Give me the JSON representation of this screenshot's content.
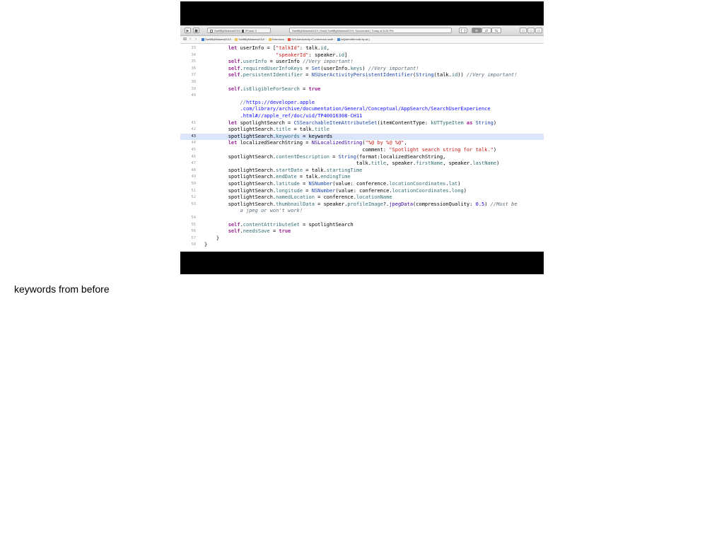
{
  "toolbar": {
    "scheme": "SwiftByMidwest2019",
    "device": "iPhone X",
    "status": "SwiftByMidwest2019 | Build SwiftByMidwest2019: Succeeded | Today at 8:28 PM"
  },
  "jumpbar": {
    "back": "‹",
    "forward": "›",
    "crumbs": [
      "SwiftByMidwest2019",
      "SwiftByMidwest2019",
      "Extension",
      "NSUserActivity+Conference.swift",
      "init(identifier:talk:by:at:)"
    ]
  },
  "code_lines": [
    {
      "n": "33",
      "html": "        <span class=\"kw\">let</span> userInfo = [<span class=\"str\">\"talkId\"</span>: talk.<span class=\"prop\">id</span>,"
    },
    {
      "n": "34",
      "html": "                        <span class=\"str\">\"speakerId\"</span>: speaker.<span class=\"prop\">id</span>]"
    },
    {
      "n": "35",
      "html": "        <span class=\"kw\">self</span>.<span class=\"prop\">userInfo</span> = userInfo <span class=\"cmt\">//Very important!</span>"
    },
    {
      "n": "36",
      "html": "        <span class=\"kw\">self</span>.<span class=\"prop\">requiredUserInfoKeys</span> = <span class=\"typ\">Set</span>(userInfo.<span class=\"prop\">keys</span>) <span class=\"cmt\">//Very important!</span>"
    },
    {
      "n": "37",
      "html": "        <span class=\"kw\">self</span>.<span class=\"prop\">persistentIdentifier</span> = <span class=\"typ\">NSUserActivityPersistentIdentifier</span>(<span class=\"typ\">String</span>(talk.<span class=\"prop\">id</span>)) <span class=\"cmt\">//Very important!</span>"
    },
    {
      "n": "38",
      "html": ""
    },
    {
      "n": "39",
      "html": "        <span class=\"kw\">self</span>.<span class=\"prop\">isEligibleForSearch</span> = <span class=\"kw\">true</span>"
    },
    {
      "n": "40",
      "html": ""
    },
    {
      "n": "",
      "html": "            <span class=\"cmt\">//</span><span class=\"url\">https://developer.apple</span>"
    },
    {
      "n": "",
      "html": "            <span class=\"url\">.com/library/archive/documentation/General/Conceptual/AppSearch/SearchUserExperience</span>"
    },
    {
      "n": "",
      "html": "            <span class=\"url\">.html#//apple_ref/doc/uid/TP40016308-CH11</span>"
    },
    {
      "n": "41",
      "html": "        <span class=\"kw\">let</span> spotlightSearch = <span class=\"typ\">CSSearchableItemAttributeSet</span>(itemContentType: <span class=\"prop\">kUTTypeItem</span> <span class=\"kw\">as</span> <span class=\"typ\">String</span>)"
    },
    {
      "n": "42",
      "html": "        spotlightSearch.<span class=\"prop\">title</span> = talk.<span class=\"prop\">title</span>"
    },
    {
      "n": "43",
      "html": "        spotlightSearch.<span class=\"prop\">keywords</span> = keywords",
      "current": true
    },
    {
      "n": "44",
      "html": "        <span class=\"kw\">let</span> localizedSearchString = <span class=\"fn\">NSLocalizedString</span>(<span class=\"str\">\"%@ by %@ %@\"</span>,"
    },
    {
      "n": "45",
      "html": "                                                     comment: <span class=\"str\">\"Spotlight search string for talk.\"</span>)"
    },
    {
      "n": "46",
      "html": "        spotlightSearch.<span class=\"prop\">contentDescription</span> = <span class=\"typ\">String</span>(format:localizedSearchString,"
    },
    {
      "n": "47",
      "html": "                                                   talk.<span class=\"prop\">title</span>, speaker.<span class=\"prop\">firstName</span>, speaker.<span class=\"prop\">lastName</span>)"
    },
    {
      "n": "48",
      "html": "        spotlightSearch.<span class=\"prop\">startDate</span> = talk.<span class=\"prop\">startingTime</span>"
    },
    {
      "n": "49",
      "html": "        spotlightSearch.<span class=\"prop\">endDate</span> = talk.<span class=\"prop\">endingTime</span>"
    },
    {
      "n": "50",
      "html": "        spotlightSearch.<span class=\"prop\">latitude</span> = <span class=\"typ\">NSNumber</span>(value: conference.<span class=\"prop\">locationCoordinates</span>.<span class=\"prop\">lat</span>)"
    },
    {
      "n": "51",
      "html": "        spotlightSearch.<span class=\"prop\">longitude</span> = <span class=\"typ\">NSNumber</span>(value: conference.<span class=\"prop\">locationCoordinates</span>.<span class=\"prop\">long</span>)"
    },
    {
      "n": "52",
      "html": "        spotlightSearch.<span class=\"prop\">namedLocation</span> = conference.<span class=\"prop\">locationName</span>"
    },
    {
      "n": "53",
      "html": "        spotlightSearch.<span class=\"prop\">thumbnailData</span> = speaker.<span class=\"prop\">profileImage</span>?.<span class=\"fn\">jpegData</span>(compressionQuality: <span class=\"num\">0.5</span>) <span class=\"cmt\">//Must be</span>"
    },
    {
      "n": "",
      "html": "            <span class=\"cmt\">a jpeg or won't work!</span>"
    },
    {
      "n": "54",
      "html": ""
    },
    {
      "n": "55",
      "html": "        <span class=\"kw\">self</span>.<span class=\"prop\">contentAttributeSet</span> = spotlightSearch"
    },
    {
      "n": "56",
      "html": "        <span class=\"kw\">self</span>.<span class=\"prop\">needsSave</span> = <span class=\"kw\">true</span>"
    },
    {
      "n": "57",
      "html": "    }"
    },
    {
      "n": "58",
      "html": "}"
    }
  ],
  "caption": "keywords from before"
}
